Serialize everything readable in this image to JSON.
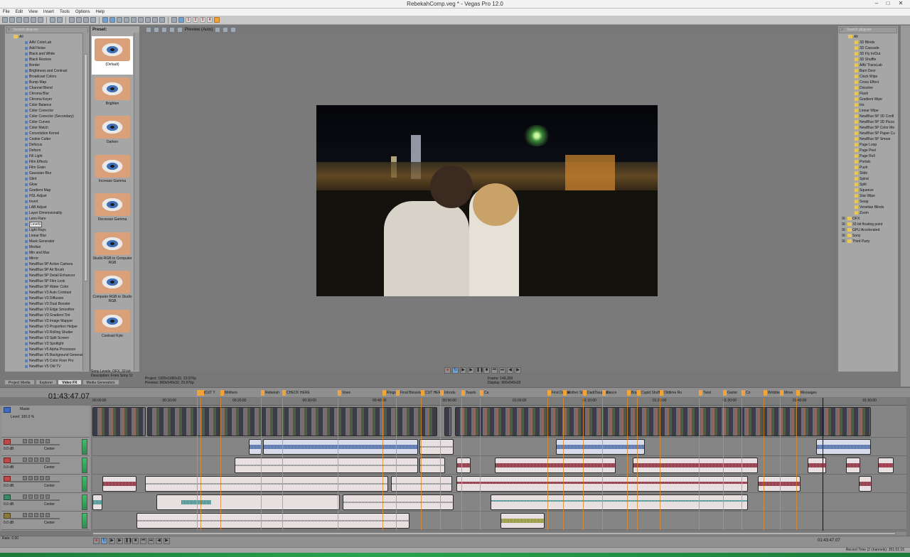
{
  "window": {
    "title": "RebekahComp.veg * - Vegas Pro 12.0"
  },
  "menu": [
    "File",
    "Edit",
    "View",
    "Insert",
    "Tools",
    "Options",
    "Help"
  ],
  "toolbar": {
    "numbers": [
      "1",
      "2",
      "3",
      "4"
    ]
  },
  "fx_panel": {
    "search_placeholder": "Search plug-ins",
    "root": "All",
    "items": [
      "AAV ColorLab",
      "Add Noise",
      "Black and White",
      "Black Restore",
      "Border",
      "Brightness and Contrast",
      "Broadcast Colors",
      "Bump Map",
      "Channel Blend",
      "Chroma Blur",
      "Chroma Keyer",
      "Color Balance",
      "Color Corrector",
      "Color Corrector (Secondary)",
      "Color Curves",
      "Color Match",
      "Convolution Kernel",
      "Cookie Cutter",
      "Defocus",
      "Deform",
      "Fill Light",
      "Film Effects",
      "Film Grain",
      "Gaussian Blur",
      "Glint",
      "Glow",
      "Gradient Map",
      "HSL Adjust",
      "Invert",
      "LAB Adjust",
      "Layer Dimensionality",
      "Lens Flare",
      "Levels",
      "Light Rays",
      "Linear Blur",
      "Mask Generator",
      "Median",
      "Min and Max",
      "Mirror",
      "NewBlue 5P Active Camera",
      "NewBlue 5P Air Brush",
      "NewBlue 5P Detail Enhancer",
      "NewBlue 5P Film Look",
      "NewBlue 5P Water Color",
      "NewBlue V3 Auto Contrast",
      "NewBlue V3 Diffusion",
      "NewBlue V3 Dual Booster",
      "NewBlue V3 Edge Smoother",
      "NewBlue V3 Gradient Tint",
      "NewBlue V3 Image Mapper",
      "NewBlue V3 Proportion Helper",
      "NewBlue V3 Rolling Shutter",
      "NewBlue V3 Split Screen",
      "NewBlue V3 Spotlight",
      "NewBlue V5 Alpha Processor",
      "NewBlue V5 Background Generator",
      "NewBlue V5 Color Fixer Pro",
      "NewBlue V5 Old TV"
    ],
    "selected": "Levels"
  },
  "presets": {
    "header": "Preset:",
    "items": [
      "(Default)",
      "Brighten",
      "Darken",
      "Increase Gamma",
      "Decrease Gamma",
      "Studio RGB to Computer RGB",
      "Computer RGB to Studio RGB",
      "Contrast Kyle"
    ],
    "selected": "(Default)",
    "info_line1": "Sony Levels: OFX, 32-bit",
    "info_line2": "Description: From Sony Cr"
  },
  "bottom_tabs": [
    "Project Media",
    "Explorer",
    "Video FX",
    "Media Generators"
  ],
  "active_tab": "Video FX",
  "preview": {
    "quality": "Preview (Auto)",
    "project_label": "Project:",
    "project_value": "1920x1080x32, 23.976p",
    "preview_label": "Preview:",
    "preview_value": "960x540x32, 23.976p",
    "frame_label": "Frame:",
    "frame_value": "149,300",
    "display_label": "Display:",
    "display_value": "960x540x32"
  },
  "transitions": {
    "search_placeholder": "Search plug-ins",
    "root": "All",
    "items": [
      "3D Blinds",
      "3D Cascade",
      "3D Fly In/Out",
      "3D Shuffle",
      "AAV TransLab",
      "Barn Door",
      "Clock Wipe",
      "Cross Effect",
      "Dissolve",
      "Flash",
      "Gradient Wipe",
      "Iris",
      "Linear Wipe",
      "NewBlue 5P 3D Confl",
      "NewBlue 5P 3D Pizza",
      "NewBlue 5P Color Me",
      "NewBlue 5P Paper Cu",
      "NewBlue 5P Smear",
      "Page Loop",
      "Page Peel",
      "Page Roll",
      "Portals",
      "Push",
      "Slide",
      "Spiral",
      "Split",
      "Squeeze",
      "Star Wipe",
      "Swap",
      "Venetian Blinds",
      "Zoom"
    ],
    "folders": [
      "OFX",
      "32-bit floating point",
      "GPU Accelerated",
      "Sony",
      "Third Party"
    ]
  },
  "timeline": {
    "clock": "01:43:47.07",
    "markers": [
      "Or",
      "CUT T",
      "Mothers",
      "Rebekah",
      "CHECK HERE",
      "Vows",
      "Rings",
      "Final Blessing",
      "CUT HERE",
      "Introdu",
      "Toasts",
      "Ca",
      "First Dance",
      "Mother So",
      "Dad/Daughter",
      "Dance",
      "Boug",
      "Cupid Shuffle",
      "Oldtime Ro",
      "Twist",
      "Garter",
      "Co",
      "Wobble",
      "Move",
      "Messages"
    ],
    "ruler": [
      "00:00:00",
      "00:10:00",
      "00:20:00",
      "00:30:00",
      "00:40:00",
      "00:50:00",
      "01:00:00",
      "01:10:00",
      "01:20:00",
      "01:30:00",
      "01:40:00",
      "01:50:00"
    ],
    "tracks": [
      {
        "type": "video",
        "name": "Maste",
        "level": "Level: 100.0 %"
      },
      {
        "type": "audio",
        "name": "",
        "level": "0.0 dB",
        "pan": "Center"
      },
      {
        "type": "audio",
        "name": "",
        "level": "0.0 dB",
        "pan": "Center"
      },
      {
        "type": "audio",
        "name": "",
        "level": "0.0 dB",
        "pan": "Center"
      },
      {
        "type": "audio",
        "name": "",
        "level": "0.0 dB",
        "pan": "Center"
      },
      {
        "type": "audio",
        "name": "",
        "level": "0.0 dB",
        "pan": "Center"
      }
    ],
    "rate": "Rate: 0.00",
    "timecode": "01:43:47.07",
    "record_time": "Record Time (2 channels): 351:01:15"
  }
}
